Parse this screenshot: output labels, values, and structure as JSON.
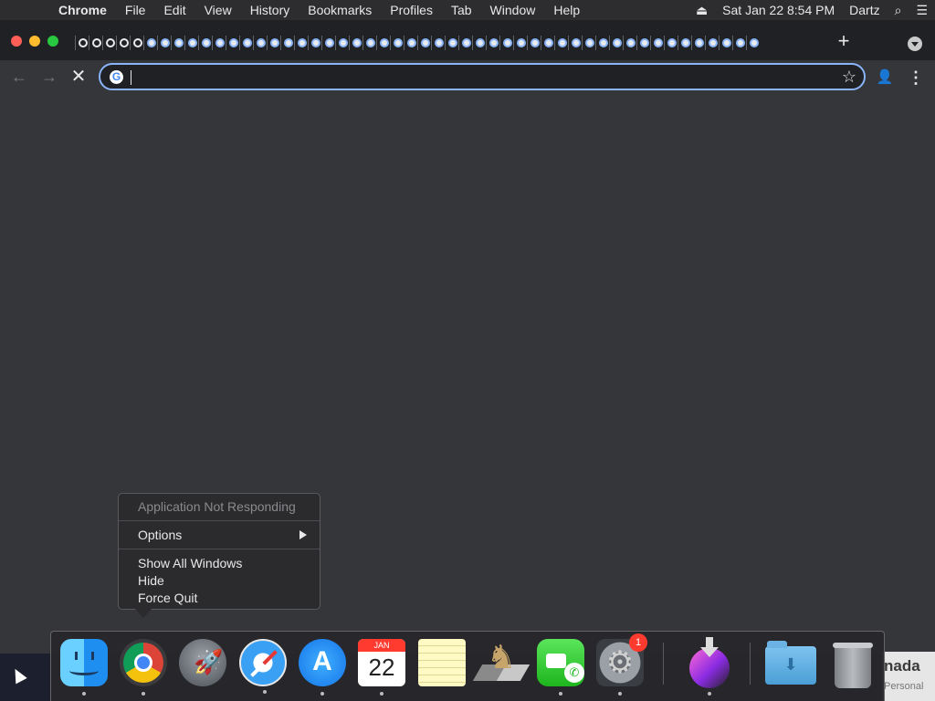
{
  "menubar": {
    "apple_glyph": "",
    "app_name": "Chrome",
    "items": [
      "File",
      "Edit",
      "View",
      "History",
      "Bookmarks",
      "Profiles",
      "Tab",
      "Window",
      "Help"
    ],
    "datetime": "Sat Jan 22  8:54 PM",
    "user": "Dartz",
    "eject_glyph": "⏏",
    "search_glyph": "⌕",
    "list_glyph": "☰"
  },
  "chrome": {
    "tab_count": 50,
    "newtab_glyph": "+",
    "back_glyph": "←",
    "forward_glyph": "→",
    "stop_glyph": "✕",
    "omnibox": {
      "value": "",
      "placeholder": "",
      "g_glyph": "G",
      "star_glyph": "☆"
    },
    "profile_glyph": "👤",
    "menu_glyph": "⋮"
  },
  "context_menu": {
    "title": "Application Not Responding",
    "options_label": "Options",
    "show_all_label": "Show All Windows",
    "hide_label": "Hide",
    "force_quit_label": "Force Quit"
  },
  "dock": {
    "calendar": {
      "month": "JAN",
      "day": "22"
    },
    "system_prefs_badge": "1",
    "launchpad_glyph": "🚀",
    "appstore_glyph": "A",
    "chess_glyph": "♞",
    "facetime_glyph": "✆",
    "gear_glyph": "⚙",
    "download_glyph": "⬇"
  },
  "background_app": {
    "title": "nada",
    "subtitle": "Personal"
  },
  "colors": {
    "accent": "#8ab4f8",
    "traffic_close": "#ff5f57",
    "traffic_min": "#febc2e",
    "traffic_max": "#28c840",
    "badge": "#ff3b30"
  }
}
